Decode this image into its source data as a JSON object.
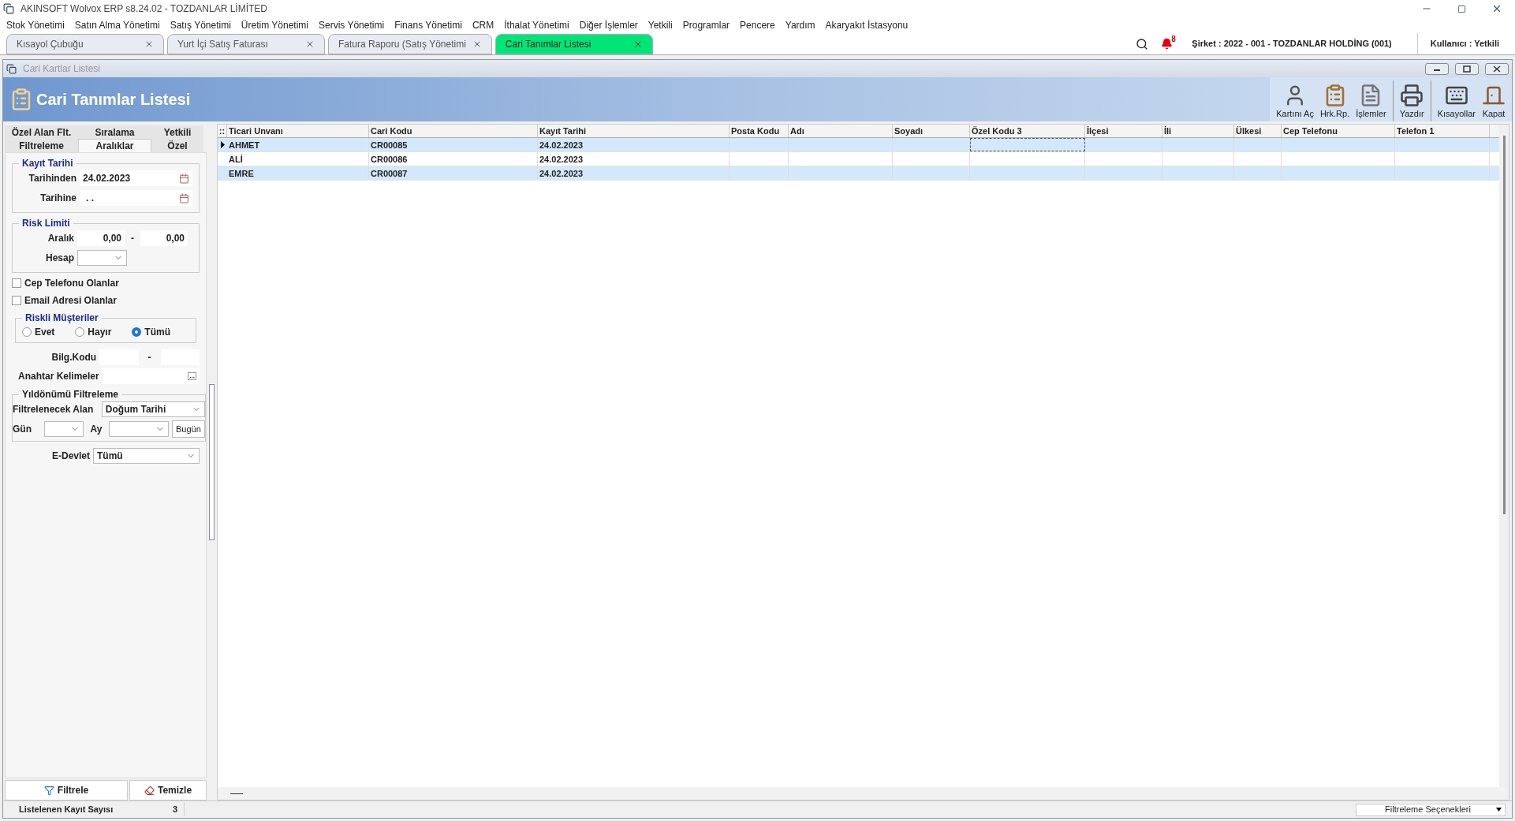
{
  "app_title": "AKINSOFT Wolvox ERP s8.24.02 - TOZDANLAR LİMİTED",
  "menu": [
    "Stok Yönetimi",
    "Satın Alma Yönetimi",
    "Satış Yönetimi",
    "Üretim Yönetimi",
    "Servis Yönetimi",
    "Finans Yönetimi",
    "CRM",
    "İthalat Yönetimi",
    "Diğer İşlemler",
    "Yetkili",
    "Programlar",
    "Pencere",
    "Yardım",
    "Akaryakıt İstasyonu"
  ],
  "doc_tabs": [
    {
      "label": "Kısayol Çubuğu",
      "selected": false
    },
    {
      "label": "Yurt İçi Satış Faturası",
      "selected": false
    },
    {
      "label": "Fatura Raporu (Satış Yönetimi",
      "selected": false
    },
    {
      "label": "Cari Tanımlar Listesi",
      "selected": true
    }
  ],
  "notification_count": "8",
  "company": "Şirket : 2022 - 001 - TOZDANLAR HOLDİNG (001)",
  "user": "Kullanıcı : Yetkili",
  "window_title": "Cari Kartlar Listesi",
  "header_title": "Cari Tanımlar Listesi",
  "toolbar": [
    {
      "label": "Kartını Aç",
      "kind": "open-card"
    },
    {
      "label": "Hrk.Rp.",
      "kind": "report"
    },
    {
      "label": "İşlemler",
      "kind": "operations"
    },
    {
      "label": "Yazdır",
      "kind": "print"
    },
    {
      "label": "Kısayollar",
      "kind": "keyboard"
    },
    {
      "label": "Kapat",
      "kind": "close"
    }
  ],
  "filter_tabs": [
    {
      "label": "Özel Alan Flt.",
      "selected": false
    },
    {
      "label": "Sıralama",
      "selected": false
    },
    {
      "label": "Yetkili",
      "selected": false
    },
    {
      "label": "Filtreleme",
      "selected": false
    },
    {
      "label": "Aralıklar",
      "selected": true
    },
    {
      "label": "Özel",
      "selected": false
    }
  ],
  "kayit_tarihi": {
    "title": "Kayıt Tarihi",
    "from_label": "Tarihinden",
    "from_value": "24.02.2023",
    "to_label": "Tarihine",
    "to_value": ". ."
  },
  "risk_limiti": {
    "title": "Risk Limiti",
    "range_label": "Aralık",
    "min": "0,00",
    "sep": "-",
    "max": "0,00",
    "account_label": "Hesap"
  },
  "checkboxes": [
    {
      "label": "Cep Telefonu Olanlar",
      "checked": false
    },
    {
      "label": "Email Adresi Olanlar",
      "checked": false
    }
  ],
  "riskli": {
    "title": "Riskli Müşteriler",
    "options": [
      {
        "label": "Evet",
        "selected": false
      },
      {
        "label": "Hayır",
        "selected": false
      },
      {
        "label": "Tümü",
        "selected": true
      }
    ]
  },
  "bilg_kodu": {
    "label": "Bilg.Kodu",
    "sep": "-"
  },
  "anahtar": {
    "label": "Anahtar Kelimeler",
    "button": "..."
  },
  "yildonumu": {
    "title": "Yıldönümü Filtreleme",
    "field_label": "Filtrelenecek Alan",
    "field_value": "Doğum Tarihi",
    "day_label": "Gün",
    "month_label": "Ay",
    "today_button": "Bugün"
  },
  "edevlet": {
    "label": "E-Devlet",
    "value": "Tümü"
  },
  "filter_button": "Filtrele",
  "clear_button": "Temizle",
  "table": {
    "indicator": "::",
    "columns": [
      "Ticari Unvanı",
      "Cari Kodu",
      "Kayıt Tarihi",
      "Posta Kodu",
      "Adı",
      "Soyadı",
      "Özel Kodu 3",
      "İlçesi",
      "İli",
      "Ülkesi",
      "Cep Telefonu",
      "Telefon 1"
    ],
    "rows": [
      {
        "selected": true,
        "cells": [
          "AHMET",
          "CR00085",
          "24.02.2023"
        ]
      },
      {
        "selected": false,
        "cells": [
          "ALİ",
          "CR00086",
          "24.02.2023"
        ]
      },
      {
        "selected": false,
        "cells": [
          "EMRE",
          "CR00087",
          "24.02.2023"
        ]
      }
    ]
  },
  "status": {
    "label": "Listelenen Kayıt Sayısı",
    "count": "3",
    "options": "Filtreleme Seçenekleri"
  }
}
